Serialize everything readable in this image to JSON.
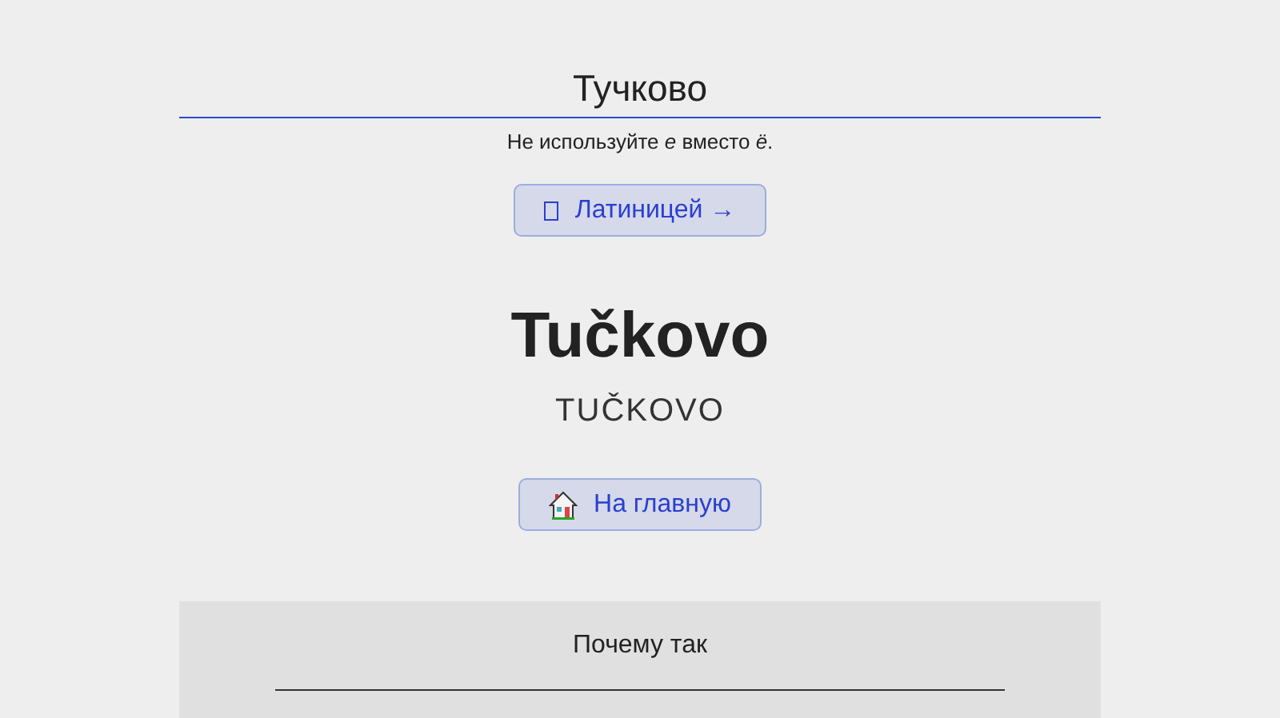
{
  "input": {
    "value": "Тучково"
  },
  "hint": "Не используйте *е* вместо *ё*.",
  "translit_button": {
    "label": "Латиницей →"
  },
  "result": {
    "title": "Tučkovo",
    "upper": "TUČKOVO"
  },
  "home_button": {
    "label": "На главную"
  },
  "panel": {
    "title": "Почему так"
  }
}
